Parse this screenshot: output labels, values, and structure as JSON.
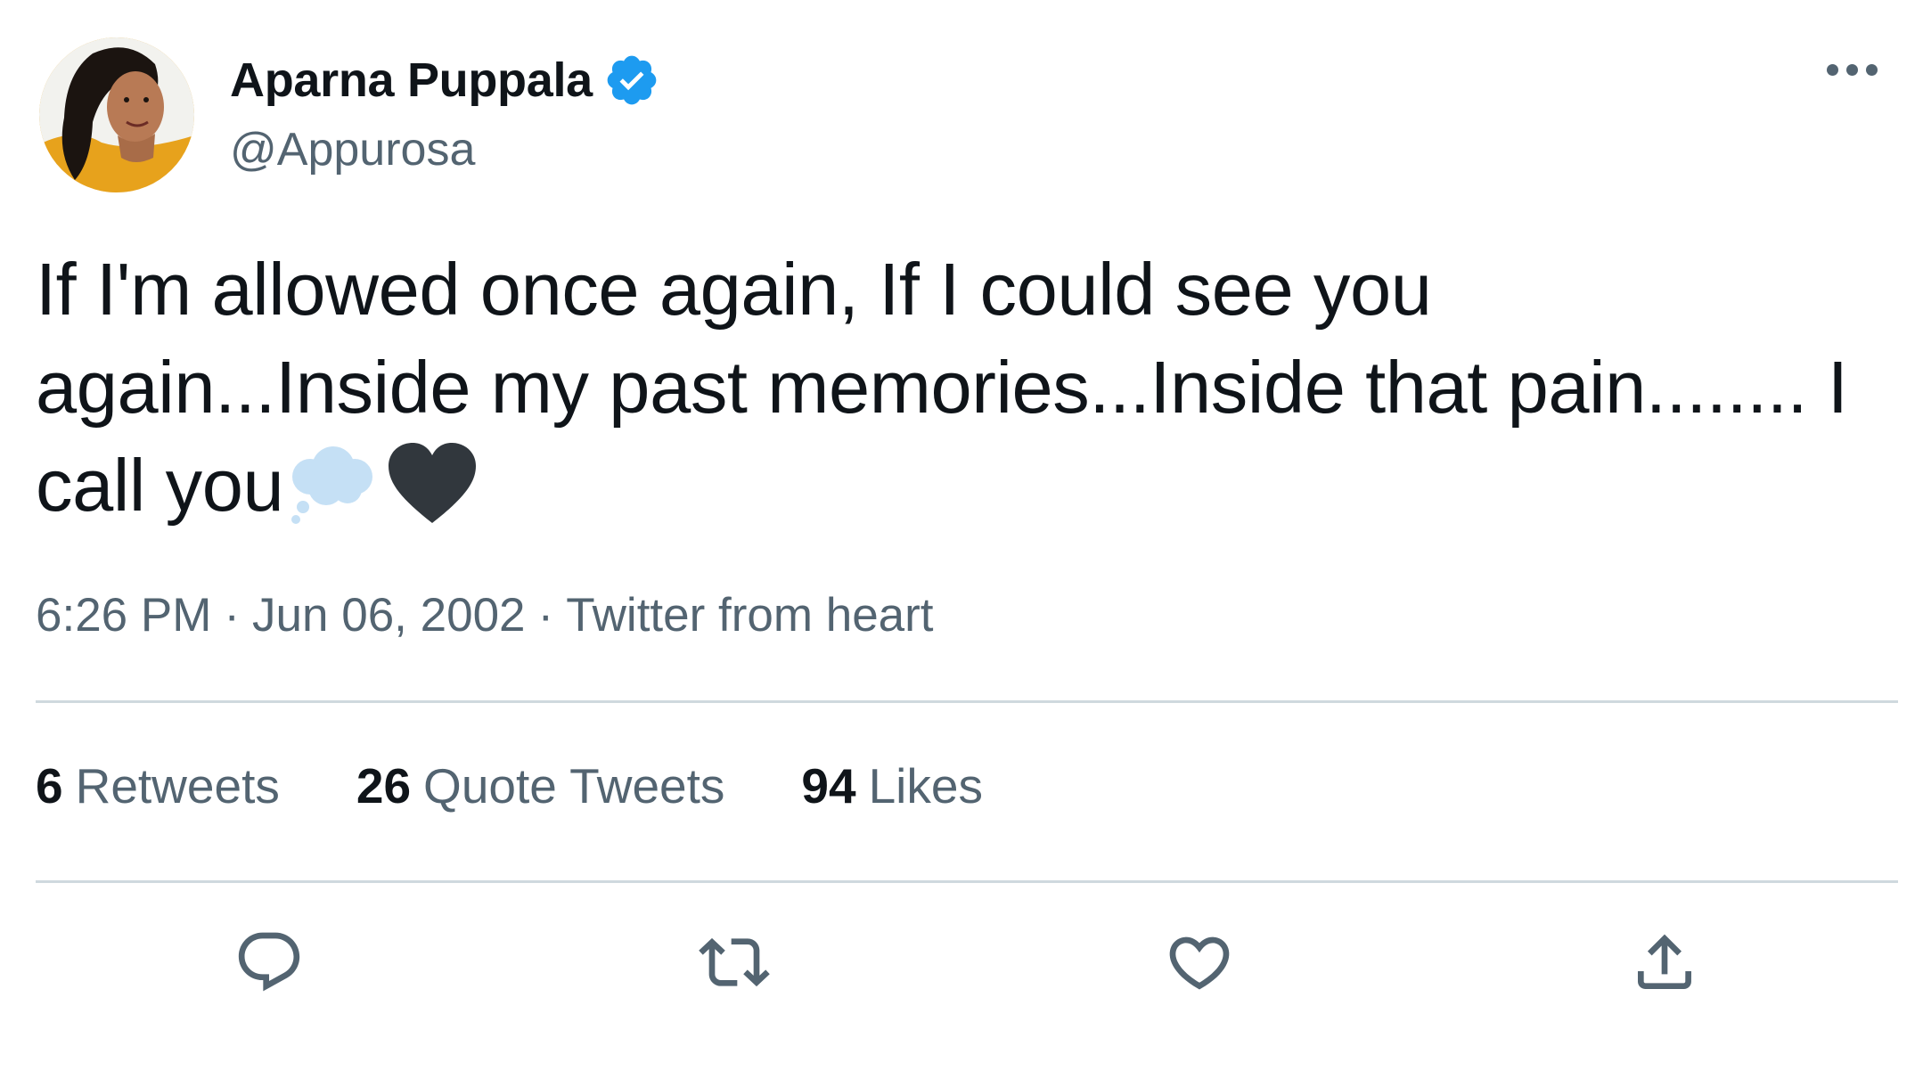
{
  "user": {
    "display_name": "Aparna Puppala",
    "handle": "@Appurosa",
    "verified": true,
    "verified_color": "#1d9bf0"
  },
  "tweet": {
    "text_lines": [
      "If I'm allowed once again, If I could see you",
      "again...Inside my past memories...Inside that pain........ I",
      "call you"
    ],
    "emojis": [
      "thought-balloon-emoji",
      "black-heart-emoji"
    ]
  },
  "meta": {
    "time": "6:26 PM",
    "separator": "·",
    "date": "Jun 06, 2002",
    "source": "Twitter from heart"
  },
  "stats": {
    "retweets_count": "6",
    "retweets_label": "Retweets",
    "quotes_count": "26",
    "quotes_label": "Quote Tweets",
    "likes_count": "94",
    "likes_label": "Likes"
  },
  "actions": [
    "reply-icon",
    "retweet-icon",
    "like-icon",
    "share-icon"
  ],
  "colors": {
    "text_primary": "#0f1419",
    "text_secondary": "#536471",
    "divider": "#cfd9de",
    "icon": "#536471"
  }
}
